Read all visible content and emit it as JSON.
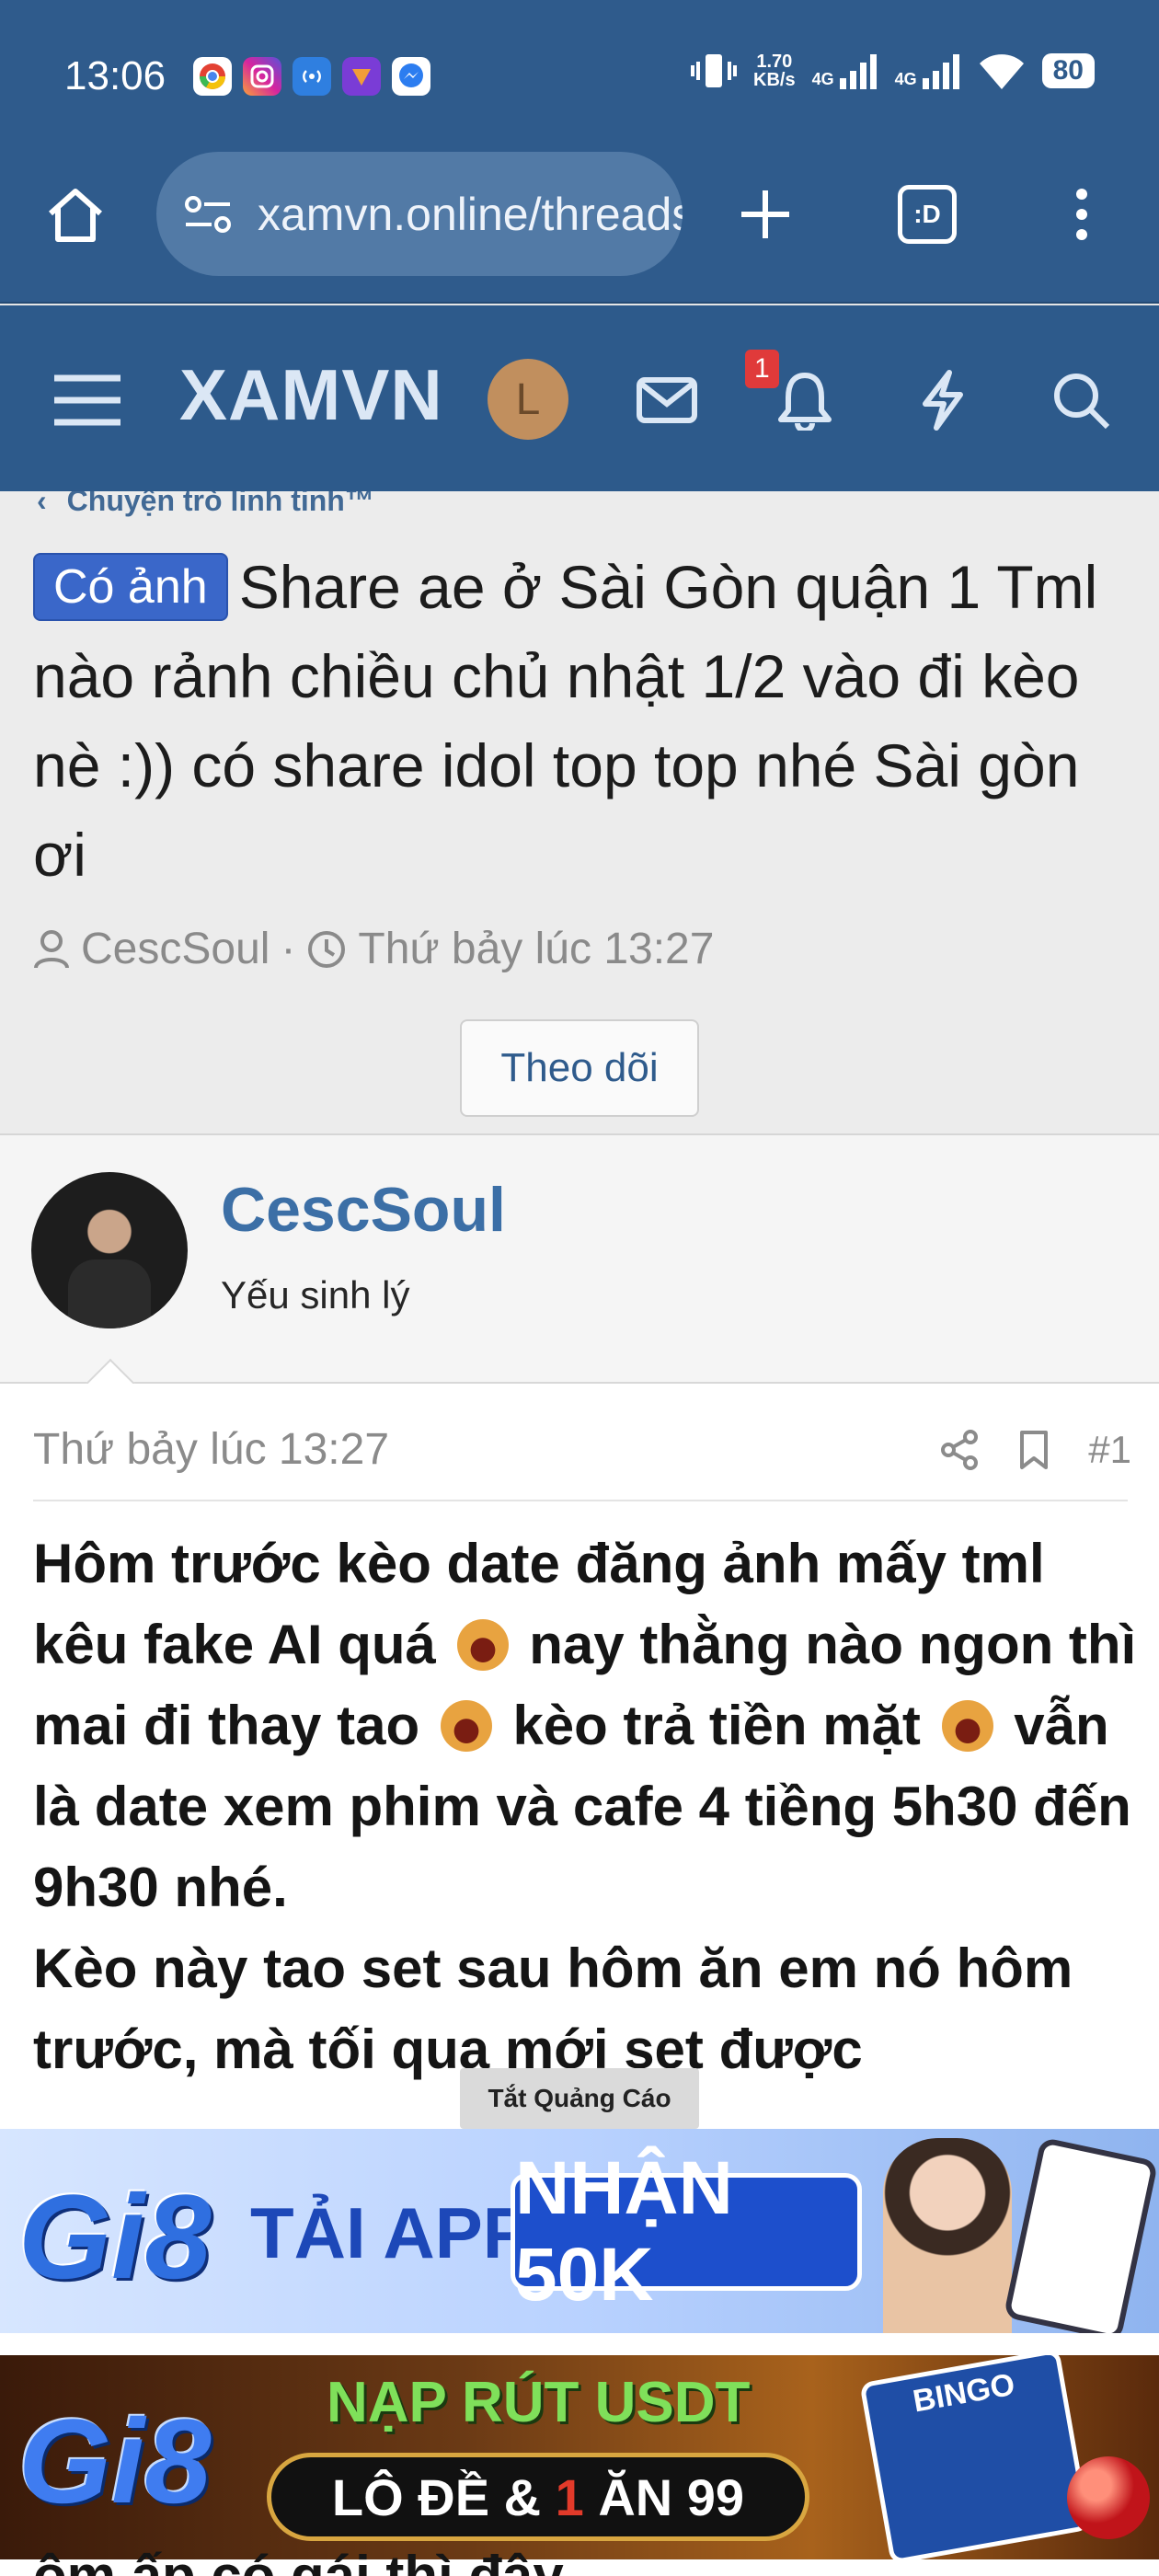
{
  "status_bar": {
    "time": "13:06",
    "net_speed_value": "1.70",
    "net_speed_unit": "KB/s",
    "net_type_1": "4G",
    "net_type_2": "4G",
    "battery": "80"
  },
  "browser": {
    "url": "xamvn.online/threads",
    "tab_count": ":D"
  },
  "site_header": {
    "logo": "XAMVN",
    "user_initial": "L",
    "notification_count": "1"
  },
  "thread": {
    "breadcrumb": "Chuyện trò linh tinh™",
    "prefix": "Có ảnh",
    "title": "Share ae ở Sài Gòn quận 1 Tml nào rảnh chiều chủ nhật 1/2 vào đi kèo nè :)) có share idol top top nhé Sài gòn ơi",
    "author": "CescSoul",
    "date": "Thứ bảy lúc 13:27",
    "follow_label": "Theo dõi"
  },
  "user": {
    "name": "CescSoul",
    "title": "Yếu sinh lý"
  },
  "post": {
    "date": "Thứ bảy lúc 13:27",
    "number": "#1",
    "body_1": "Hôm trước kèo date đăng ảnh mấy tml kêu fake AI quá",
    "body_2": "nay thằng nào ngon thì mai đi thay tao",
    "body_3": "kèo trả tiền mặt",
    "body_4": "vẫn là date xem phim và cafe 4 tiềng 5h30 đến 9h30 nhé.",
    "body_5": "Kèo này tao set sau hôm ăn em nó hôm trước, mà tối qua mới set được",
    "bottom_partial": "ôm ấp có gái thì đây."
  },
  "ads": {
    "close_label": "Tắt Quảng Cáo",
    "ad1_brand": "Gi8",
    "ad1_text": "TẢI APP",
    "ad1_pill": "NHẬN 50K",
    "ad2_brand": "Gi8",
    "ad2_top": "NẠP RÚT USDT",
    "ad2_pill_a": "LÔ ĐỀ &",
    "ad2_pill_b": "1",
    "ad2_pill_c": "ĂN 99",
    "ad2_bingo": "BINGO"
  }
}
